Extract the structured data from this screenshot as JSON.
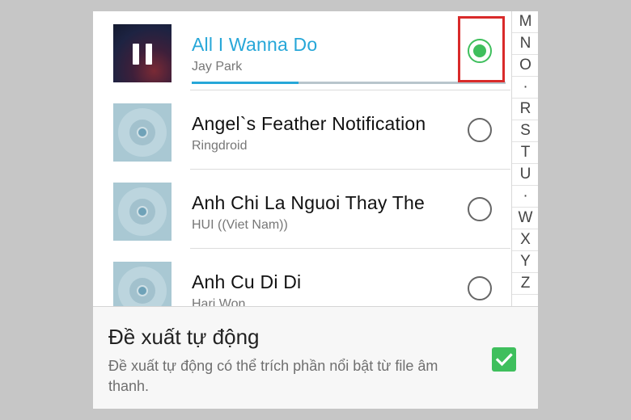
{
  "songs": [
    {
      "title": "All I Wanna Do",
      "artist": "Jay Park",
      "selected": true,
      "playing": true,
      "progress_fraction": 0.34,
      "thumb_icon": "album-art-icon"
    },
    {
      "title": "Angel`s Feather Notification",
      "artist": "Ringdroid",
      "selected": false,
      "thumb_icon": "disc-icon"
    },
    {
      "title": "Anh Chi La Nguoi Thay The",
      "artist": "HUI ((Viet Nam))",
      "selected": false,
      "thumb_icon": "disc-icon"
    },
    {
      "title": "Anh Cu Di Di",
      "artist": "Hari Won",
      "selected": false,
      "thumb_icon": "disc-icon"
    }
  ],
  "index_letters": [
    "M",
    "N",
    "O",
    "·",
    "R",
    "S",
    "T",
    "U",
    "·",
    "W",
    "X",
    "Y",
    "Z"
  ],
  "auto_suggest": {
    "title": "Đề xuất tự động",
    "description": "Đề xuất tự động có thể trích phần nổi bật từ file âm thanh.",
    "checked": true
  },
  "colors": {
    "accent": "#27a7d8",
    "selected_green": "#3fbf5d",
    "highlight_red": "#d92a2a"
  }
}
